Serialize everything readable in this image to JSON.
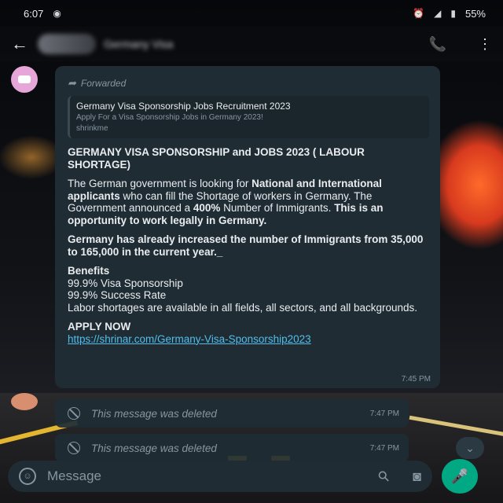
{
  "status_bar": {
    "time": "6:07",
    "battery": "55%",
    "icons": [
      "notification-icon",
      "alarm-icon",
      "signal-icon",
      "battery-icon"
    ]
  },
  "app_bar": {
    "contact_name": "Germany Visa",
    "icons": [
      "back-arrow-icon",
      "call-add-icon",
      "more-vertical-icon"
    ]
  },
  "chat": {
    "sender_name": "Germany Visa",
    "forwarded_label": "Forwarded",
    "preview": {
      "title": "Germany Visa Sponsorship Jobs Recruitment 2023",
      "subtitle": "Apply For a Visa Sponsorship Jobs in Germany 2023!",
      "domain": "shrinkme"
    },
    "message": {
      "heading": "GERMANY VISA SPONSORSHIP and JOBS 2023 ( LABOUR SHORTAGE)",
      "para1_a": "The German government is looking for ",
      "para1_b": "National and International applicants",
      "para1_c": " who can fill the Shortage of workers in Germany. The Government announced a ",
      "para1_d": "400% ",
      "para1_e": "Number of Immigrants. ",
      "para1_f": "This is an opportunity to work legally in Germany.",
      "para2": "Germany has already increased the number of Immigrants from 35,000 to 165,000 in the current year._",
      "benefits_title": "Benefits",
      "benefits": [
        "99.9% Visa Sponsorship",
        "99.9% Success Rate",
        "Labor shortages are available in all fields, all sectors, and all backgrounds."
      ],
      "apply_label": "APPLY NOW",
      "link": "https://shrinar.com/Germany-Visa-Sponsorship2023",
      "time": "7:45 PM"
    },
    "deleted_messages": [
      {
        "text": "This message was deleted",
        "time": "7:47 PM"
      },
      {
        "text": "This message was deleted",
        "time": "7:47 PM"
      }
    ]
  },
  "composer": {
    "placeholder": "Message",
    "icons": [
      "emoji-icon",
      "attach-icon",
      "camera-icon",
      "mic-icon"
    ]
  },
  "colors": {
    "bubble": "#1f2c34",
    "accent": "#00a884",
    "link": "#53bdeb"
  }
}
